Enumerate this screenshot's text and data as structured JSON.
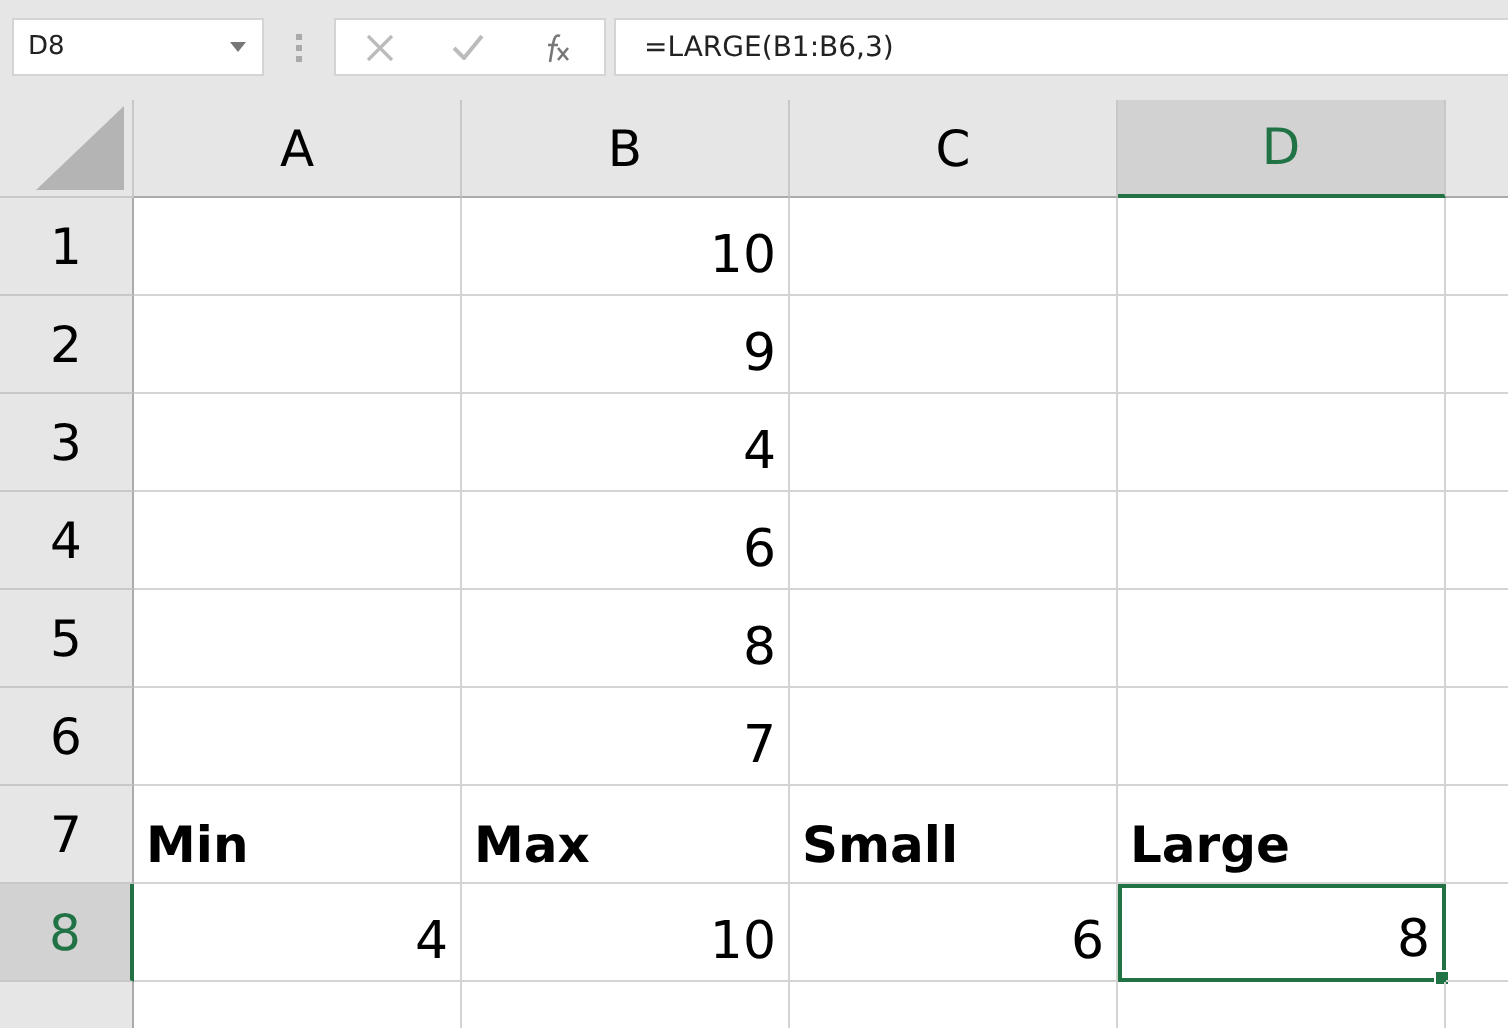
{
  "formula_bar": {
    "name_box": "D8",
    "formula": "=LARGE(B1:B6,3)"
  },
  "columns": [
    {
      "label": "A",
      "selected": false
    },
    {
      "label": "B",
      "selected": false
    },
    {
      "label": "C",
      "selected": false
    },
    {
      "label": "D",
      "selected": true
    }
  ],
  "rows": [
    {
      "label": "1",
      "selected": false,
      "kind": "value",
      "cells": [
        {
          "selected": false
        },
        {
          "text": "10",
          "selected": false
        },
        {
          "selected": false
        },
        {
          "selected": false
        }
      ]
    },
    {
      "label": "2",
      "selected": false,
      "kind": "value",
      "cells": [
        {
          "selected": false
        },
        {
          "text": "9",
          "selected": false
        },
        {
          "selected": false
        },
        {
          "selected": false
        }
      ]
    },
    {
      "label": "3",
      "selected": false,
      "kind": "value",
      "cells": [
        {
          "selected": false
        },
        {
          "text": "4",
          "selected": false
        },
        {
          "selected": false
        },
        {
          "selected": false
        }
      ]
    },
    {
      "label": "4",
      "selected": false,
      "kind": "value",
      "cells": [
        {
          "selected": false
        },
        {
          "text": "6",
          "selected": false
        },
        {
          "selected": false
        },
        {
          "selected": false
        }
      ]
    },
    {
      "label": "5",
      "selected": false,
      "kind": "value",
      "cells": [
        {
          "selected": false
        },
        {
          "text": "8",
          "selected": false
        },
        {
          "selected": false
        },
        {
          "selected": false
        }
      ]
    },
    {
      "label": "6",
      "selected": false,
      "kind": "value",
      "cells": [
        {
          "selected": false
        },
        {
          "text": "7",
          "selected": false
        },
        {
          "selected": false
        },
        {
          "selected": false
        }
      ]
    },
    {
      "label": "7",
      "selected": false,
      "kind": "label",
      "cells": [
        {
          "text": "Min",
          "selected": false
        },
        {
          "text": "Max",
          "selected": false
        },
        {
          "text": "Small",
          "selected": false
        },
        {
          "text": "Large",
          "selected": false
        }
      ]
    },
    {
      "label": "8",
      "selected": true,
      "kind": "value",
      "cells": [
        {
          "text": "4",
          "selected": false
        },
        {
          "text": "10",
          "selected": false
        },
        {
          "text": "6",
          "selected": false
        },
        {
          "text": "8",
          "selected": true
        }
      ]
    },
    {
      "selected": false,
      "kind": "value",
      "cells": [
        {
          "selected": false
        },
        {
          "selected": false
        },
        {
          "selected": false
        },
        {
          "selected": false
        }
      ]
    }
  ]
}
